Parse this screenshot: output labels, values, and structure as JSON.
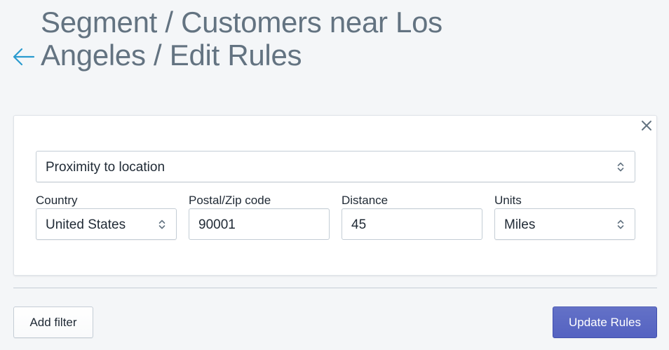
{
  "header": {
    "back_icon": "arrow-left-icon",
    "title": "Segment / Customers near Los Angeles / Edit Rules"
  },
  "filter_card": {
    "close_icon": "close-icon",
    "filter_type": {
      "selected": "Proximity to location"
    },
    "fields": {
      "country": {
        "label": "Country",
        "selected": "United States"
      },
      "postal_code": {
        "label": "Postal/Zip code",
        "value": "90001"
      },
      "distance": {
        "label": "Distance",
        "value": "45"
      },
      "units": {
        "label": "Units",
        "selected": "Miles"
      }
    }
  },
  "footer": {
    "add_filter_label": "Add filter",
    "update_rules_label": "Update Rules"
  },
  "colors": {
    "background": "#f4f6f8",
    "accent_arrow": "#2a9bcf",
    "primary_button": "#5c6ac4",
    "title_text": "#637381"
  }
}
